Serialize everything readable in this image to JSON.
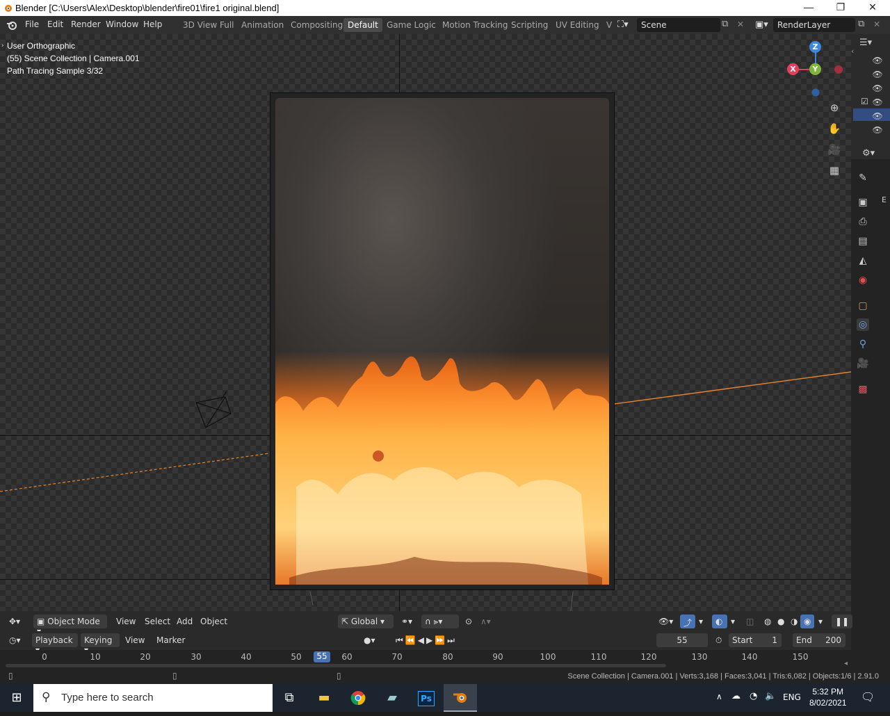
{
  "window": {
    "title": "Blender [C:\\Users\\Alex\\Desktop\\blender\\fire01\\fire1 original.blend]",
    "minimize": "—",
    "maximize": "❐",
    "close": "✕"
  },
  "menu": [
    "File",
    "Edit",
    "Render",
    "Window",
    "Help"
  ],
  "workspaces": [
    "3D View Full",
    "Animation",
    "Compositing",
    "Default",
    "Game Logic",
    "Motion Tracking",
    "Scripting",
    "UV Editing",
    "V"
  ],
  "active_workspace": "Default",
  "scene_field": "Scene",
  "renderlayer_field": "RenderLayer",
  "viewport": {
    "view_name": "User Orthographic",
    "collection_info": "(55) Scene Collection | Camera.001",
    "sample_info": "Path Tracing Sample 3/32",
    "gizmo": {
      "z": "Z",
      "y": "Y",
      "x": "X"
    }
  },
  "vp_header": {
    "mode": "Object Mode",
    "menus": [
      "View",
      "Select",
      "Add",
      "Object"
    ],
    "orientation": "Global"
  },
  "timeline": {
    "menus": [
      "Playback",
      "Keying",
      "View",
      "Marker"
    ],
    "current_frame": "55",
    "start_label": "Start",
    "start": "1",
    "end_label": "End",
    "end": "200",
    "ticks": [
      "0",
      "10",
      "20",
      "30",
      "40",
      "50",
      "60",
      "70",
      "80",
      "90",
      "100",
      "110",
      "120",
      "130",
      "140",
      "150"
    ]
  },
  "status": "Scene Collection | Camera.001 | Verts:3,168 | Faces:3,041 | Tris:6,082 | Objects:1/6 | 2.91.0",
  "taskbar": {
    "search_placeholder": "Type here to search",
    "lang": "ENG",
    "time": "5:32 PM",
    "date": "8/02/2021"
  },
  "sidebar_label": "E",
  "colors": {
    "accent": "#4772b3",
    "x_axis": "#e0405a",
    "y_axis": "#7fb53a",
    "z_axis": "#3d87e0",
    "camera_line": "#e8852a"
  }
}
